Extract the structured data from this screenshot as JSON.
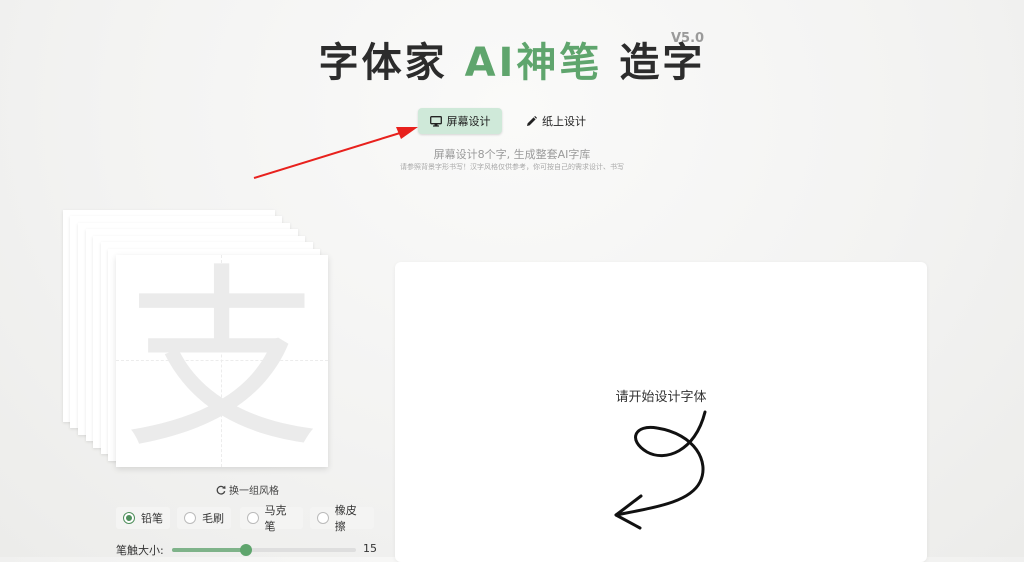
{
  "header": {
    "title_part1": "字体家",
    "title_ai": "AI神笔",
    "title_part2": "造字",
    "version": "V5.0"
  },
  "modes": {
    "screen": {
      "label": "屏幕设计",
      "icon": "monitor-icon",
      "active": true
    },
    "paper": {
      "label": "纸上设计",
      "icon": "pencil-icon",
      "active": false
    }
  },
  "subtitle": {
    "line1": "屏幕设计8个字, 生成整套AI字库",
    "line2": "请参照背景字形书写！汉字风格仅供参考，你可按自己的需求设计、书写"
  },
  "reference": {
    "character": "支",
    "swap_label": "换一组风格",
    "swap_icon": "refresh-icon"
  },
  "tools": [
    {
      "label": "铅笔",
      "selected": true
    },
    {
      "label": "毛刷",
      "selected": false
    },
    {
      "label": "马克笔",
      "selected": false
    },
    {
      "label": "橡皮擦",
      "selected": false
    }
  ],
  "brush": {
    "label": "笔触大小:",
    "value": "15",
    "level": 0.4
  },
  "canvas": {
    "hint": "请开始设计字体"
  },
  "colors": {
    "accent": "#5fa56d",
    "active_button": "#cfe9d9",
    "arrow": "#e8211d"
  }
}
